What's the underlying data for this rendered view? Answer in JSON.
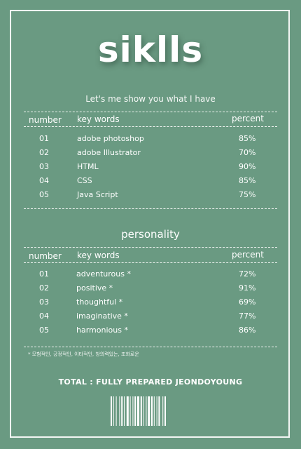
{
  "title": "siklls",
  "subtitle": "Let's me show you what I have",
  "skills": {
    "headers": [
      "number",
      "key words",
      "percent"
    ],
    "rows": [
      [
        "01",
        "adobe photoshop",
        "85%"
      ],
      [
        "02",
        "adobe Illustrator",
        "70%"
      ],
      [
        "03",
        "HTML",
        "90%"
      ],
      [
        "04",
        "CSS",
        "85%"
      ],
      [
        "05",
        "Java Script",
        "75%"
      ]
    ]
  },
  "personality": {
    "title": "personality",
    "headers": [
      "number",
      "key words",
      "percent"
    ],
    "rows": [
      [
        "01",
        "adventurous *",
        "72%"
      ],
      [
        "02",
        "positive *",
        "91%"
      ],
      [
        "03",
        "thoughtful *",
        "69%"
      ],
      [
        "04",
        "imaginative *",
        "77%"
      ],
      [
        "05",
        "harmonious *",
        "86%"
      ]
    ]
  },
  "note": "* 모험적인, 긍정적인, 이타적인, 창의력있는, 조화로운",
  "total": "TOTAL :  FULLY PREPARED JEONDOYOUNG",
  "colors": {
    "background": "#6a9a82",
    "foreground": "#ffffff"
  }
}
